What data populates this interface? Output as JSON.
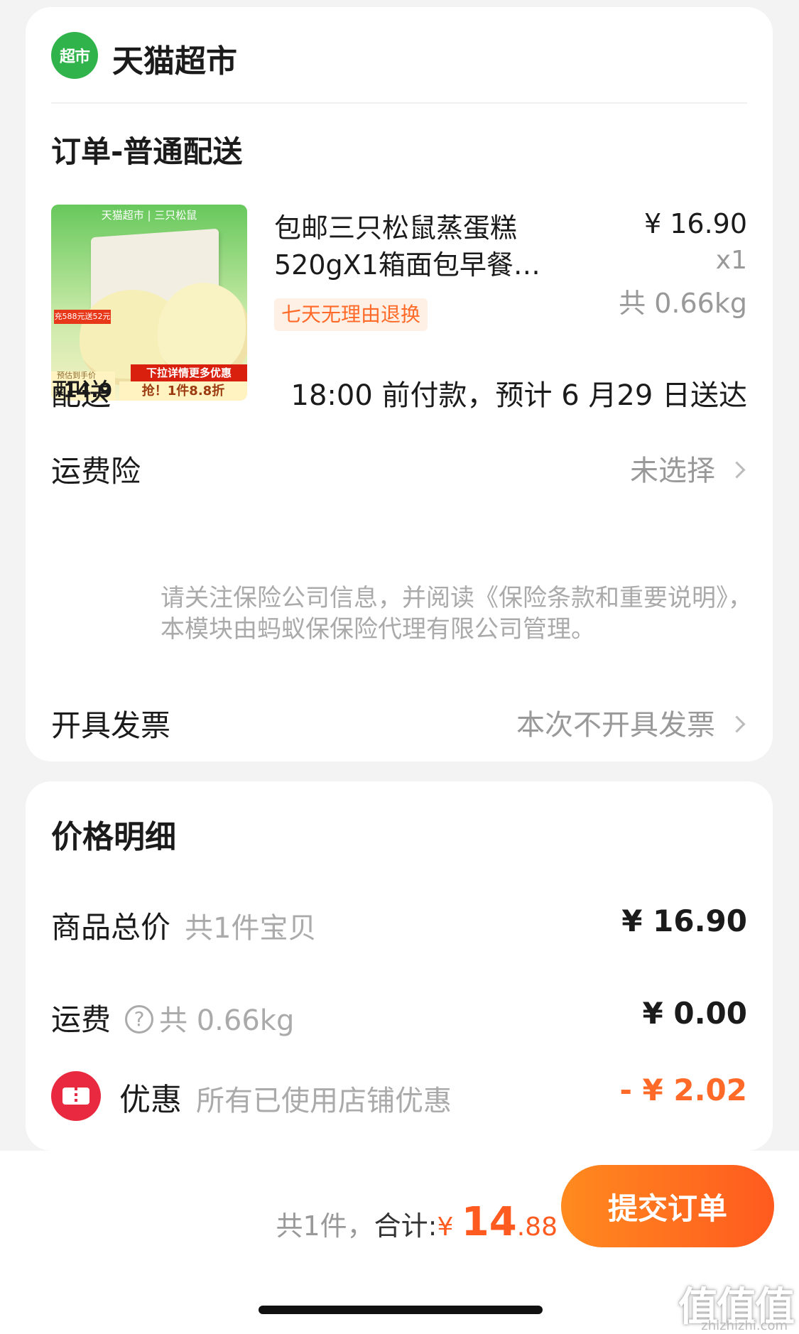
{
  "store": {
    "logo_text": "超市",
    "name": "天猫超市"
  },
  "order": {
    "title": "订单-普通配送"
  },
  "product": {
    "image": {
      "header": "天猫超市 | 三只松鼠",
      "badge": "充588元送52元",
      "ribbon": "下拉详情更多优惠",
      "price_note": "预估到手价",
      "price": "14.9",
      "deal": "抢！1件8.8折"
    },
    "title_line1": "包邮三只松鼠蒸蛋糕",
    "title_line2": "520gX1箱面包早餐…",
    "return_badge": "七天无理由退换",
    "price": "¥ 16.90",
    "qty": "x1",
    "weight": "共 0.66kg"
  },
  "delivery": {
    "label": "配送",
    "value": "18:00 前付款，预计 6 月29 日送达"
  },
  "insurance": {
    "label": "运费险",
    "value": "未选择",
    "note": "请关注保险公司信息，并阅读《保险条款和重要说明》，本模块由蚂蚁保保险代理有限公司管理。"
  },
  "invoice": {
    "label": "开具发票",
    "value": "本次不开具发票"
  },
  "price_detail": {
    "title": "价格明细",
    "goods_label": "商品总价",
    "goods_sub": "共1件宝贝",
    "goods_value": "¥ 16.90",
    "shipping_label": "运费",
    "shipping_icon": "?",
    "shipping_sub": "共 0.66kg",
    "shipping_value": "¥ 0.00",
    "discount_label": "优惠",
    "discount_sub": "所有已使用店铺优惠",
    "discount_value": "- ¥ 2.02"
  },
  "bottom": {
    "count": "共1件，",
    "total_label": "合计:",
    "currency": "¥ ",
    "total_int": "14",
    "total_dec": ".88",
    "submit": "提交订单"
  },
  "watermark": {
    "main": "值值值",
    "sub": "zhizhizhi.com"
  },
  "colors": {
    "accent": "#ff5a1f",
    "store_green": "#2fb34a",
    "coupon_red": "#e8293f"
  }
}
